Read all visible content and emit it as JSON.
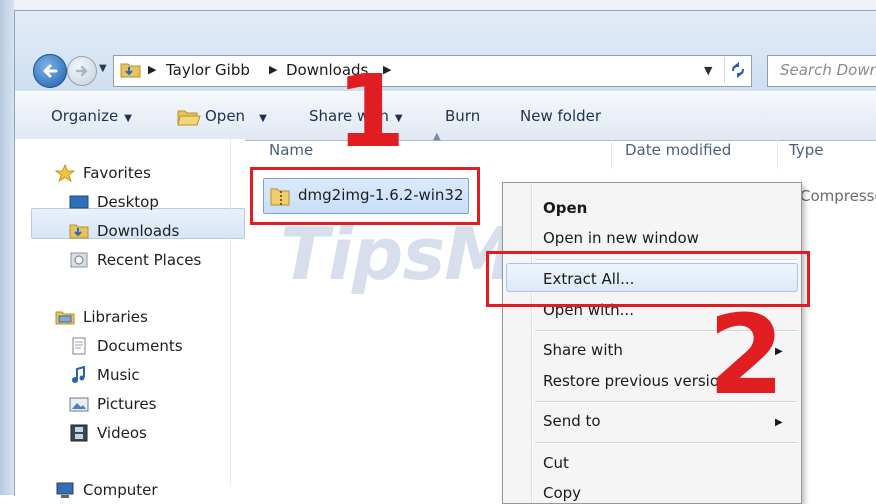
{
  "address": {
    "crumbs": [
      "Taylor Gibb",
      "Downloads"
    ],
    "search_placeholder": "Search Downloads"
  },
  "toolbar": {
    "organize": "Organize",
    "open": "Open",
    "share_with": "Share with",
    "burn": "Burn",
    "new_folder": "New folder"
  },
  "nav": {
    "favorites": "Favorites",
    "desktop": "Desktop",
    "downloads": "Downloads",
    "recent_places": "Recent Places",
    "libraries": "Libraries",
    "documents": "Documents",
    "music": "Music",
    "pictures": "Pictures",
    "videos": "Videos",
    "computer": "Computer"
  },
  "columns": {
    "name": "Name",
    "date_modified": "Date modified",
    "type": "Type"
  },
  "files": [
    {
      "name": "dmg2img-1.6.2-win32",
      "type": "Compressed"
    }
  ],
  "context_menu": {
    "open": "Open",
    "open_new_window": "Open in new window",
    "extract_all": "Extract All...",
    "open_with": "Open with...",
    "share_with": "Share with",
    "restore_previous": "Restore previous versions",
    "send_to": "Send to",
    "cut": "Cut",
    "copy": "Copy"
  },
  "annotations": {
    "step1": "1",
    "step2": "2",
    "watermark": "TipsMake",
    "color": "#e01e22"
  }
}
